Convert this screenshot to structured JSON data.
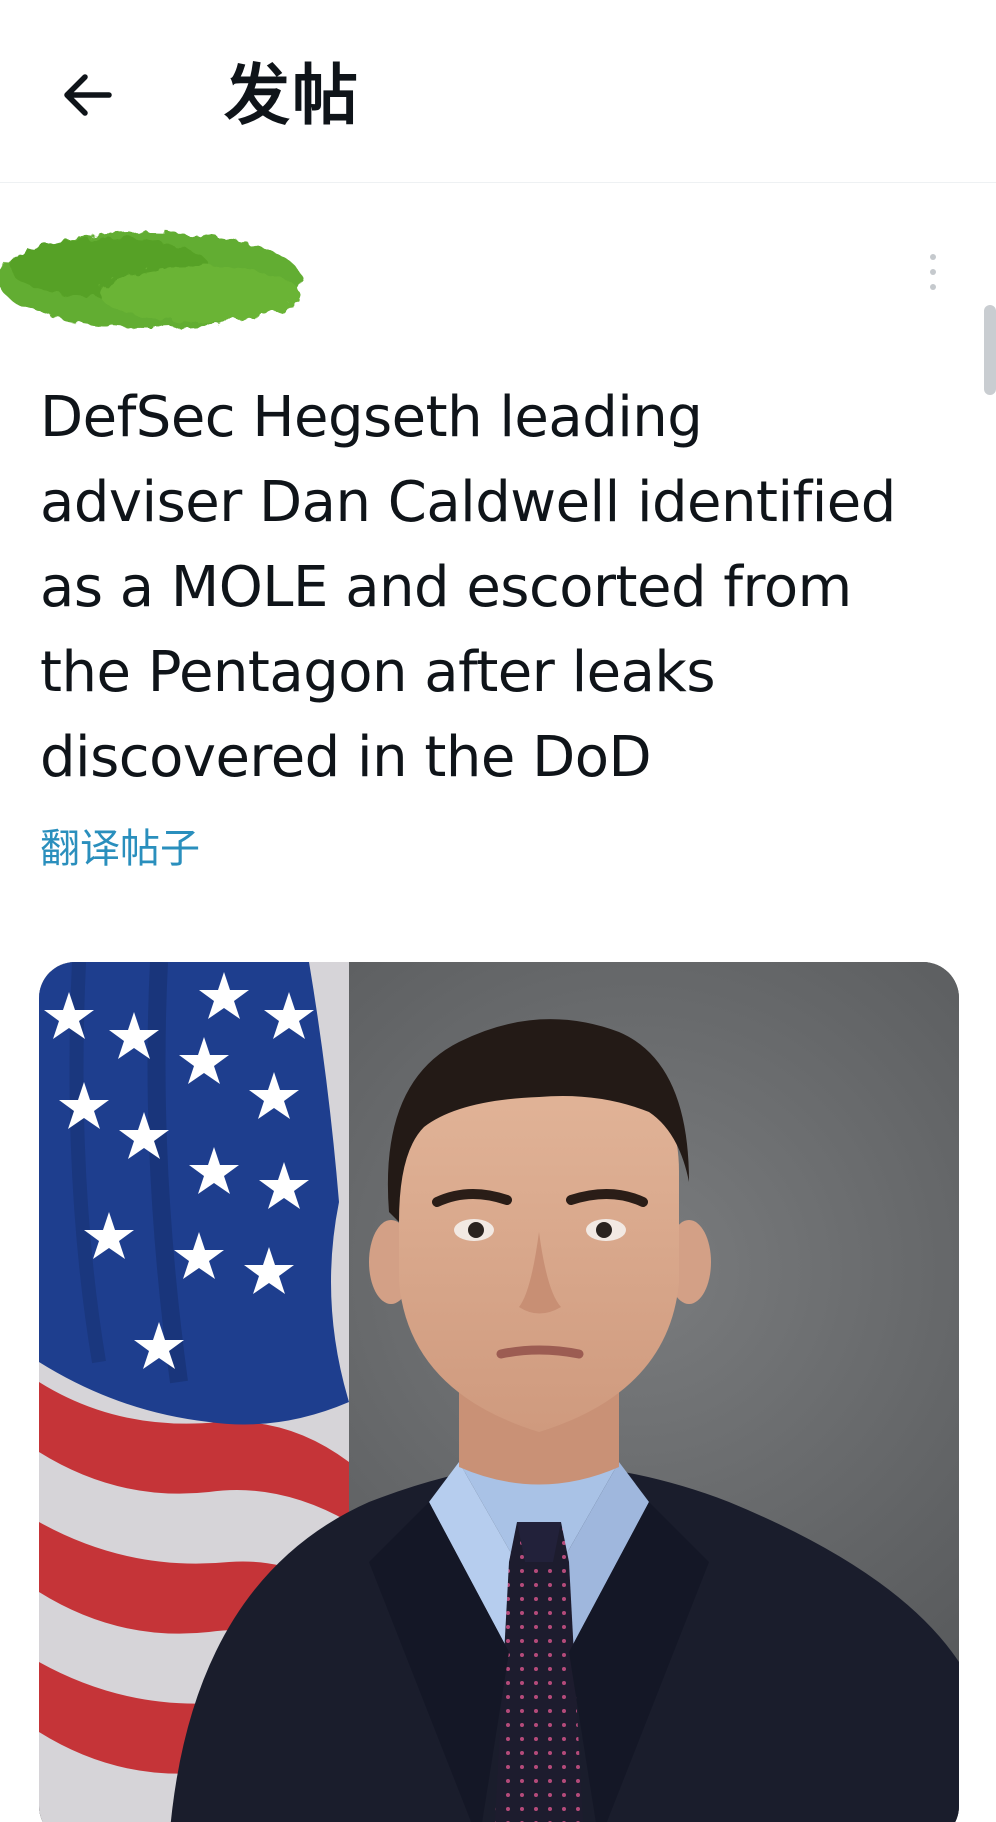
{
  "header": {
    "back_icon": "arrow-left-icon",
    "title": "发帖"
  },
  "post": {
    "author_redacted": true,
    "more_icon": "more-vertical-icon",
    "text_lines": [
      "DefSec Hegseth leading",
      "adviser Dan Caldwell identified",
      "as a MOLE and escorted from",
      "the Pentagon after leaks",
      "discovered in the DoD"
    ],
    "translate_label": "翻译帖子",
    "media": {
      "kind": "photo",
      "subject": "official-portrait-with-us-flag"
    }
  },
  "colors": {
    "link": "#2a8fbd",
    "redaction_green": "#5aa62b",
    "text": "#0f1419"
  }
}
